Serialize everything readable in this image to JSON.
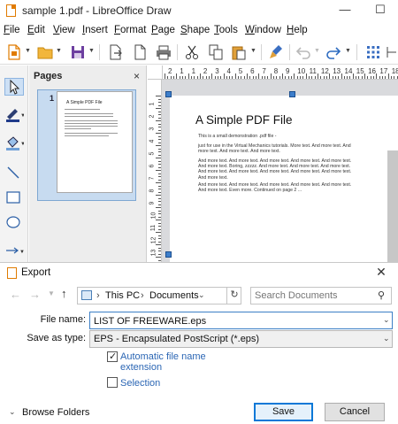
{
  "app": {
    "window_title": "sample 1.pdf - LibreOffice Draw",
    "min_glyph": "—",
    "max_glyph": "☐"
  },
  "menu": [
    "File",
    "Edit",
    "View",
    "Insert",
    "Format",
    "Page",
    "Shape",
    "Tools",
    "Window",
    "Help"
  ],
  "pages_panel": {
    "title": "Pages",
    "close_glyph": "×",
    "page_number": "1",
    "thumb_title": "A Simple PDF File"
  },
  "ruler": {
    "h_numbers": [
      "2",
      "1",
      "1",
      "2",
      "3",
      "4",
      "5",
      "6",
      "7",
      "8",
      "9",
      "10",
      "11",
      "12",
      "13",
      "14",
      "15",
      "16",
      "17",
      "18"
    ],
    "v_numbers": [
      "1",
      "2",
      "3",
      "4",
      "5",
      "6",
      "7",
      "8",
      "9",
      "10",
      "11",
      "12",
      "13"
    ]
  },
  "document": {
    "title": "A Simple PDF File",
    "para1": "This is a small demonstration .pdf file -",
    "para2": "just for use in the Virtual Mechanics tutorials. More text. And more text. And more text. And more text. And more text.",
    "para3": "And more text. And more text. And more text. And more text. And more text. And more text. Boring, zzzzz. And more text. And more text. And more text. And more text. And more text. And more text. And more text. And more text. And more text.",
    "para4": "And more text. And more text. And more text. And more text. And more text. And more text. Even more. Continued on page 2 ..."
  },
  "dialog": {
    "title": "Export",
    "close_glyph": "✕",
    "breadcrumb": [
      "This PC",
      "Documents"
    ],
    "search_placeholder": "Search Documents",
    "file_name_label": "File name:",
    "file_name_value": "LIST OF FREEWARE.eps",
    "save_type_label": "Save as type:",
    "save_type_value": "EPS - Encapsulated PostScript (*.eps)",
    "auto_ext_label": "Automatic file name extension",
    "auto_ext_checked": true,
    "selection_label": "Selection",
    "selection_checked": false,
    "browse_label": "Browse Folders",
    "save_button": "Save",
    "cancel_button": "Cancel"
  },
  "colors": {
    "accent": "#0a78d7",
    "link_blue": "#2b66b4",
    "handle_blue": "#3d7ecb",
    "canvas_bg": "#d9dadd",
    "panel_bg": "#ededed"
  }
}
